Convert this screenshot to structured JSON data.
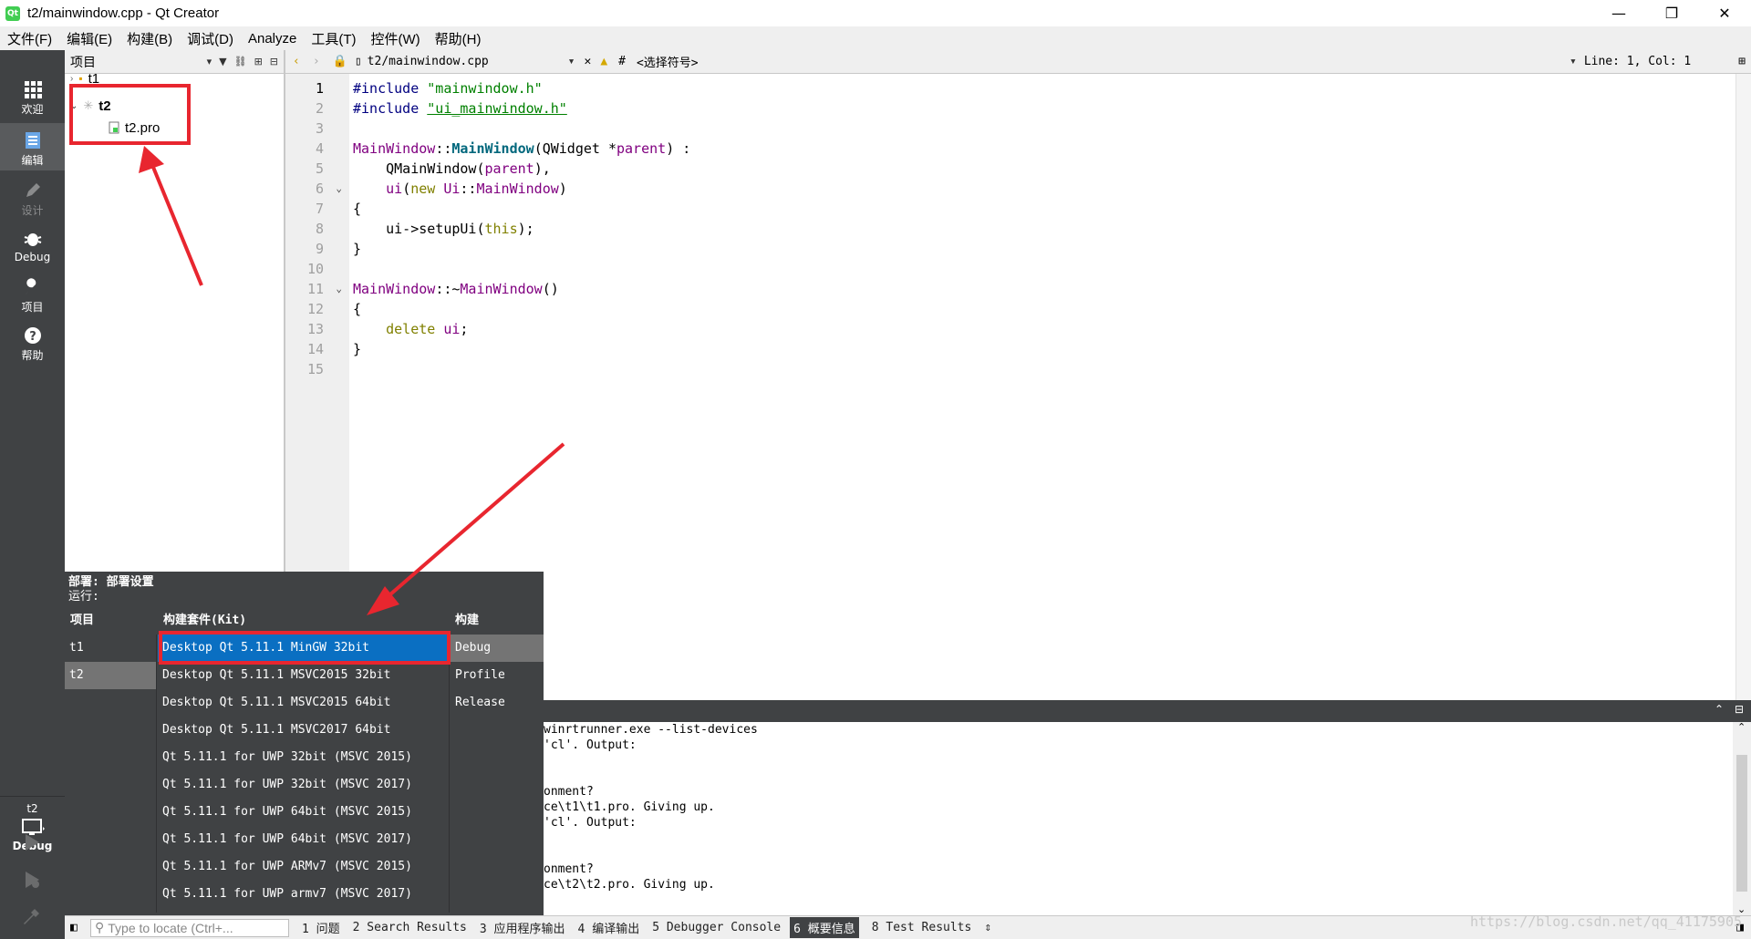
{
  "window": {
    "title": "t2/mainwindow.cpp - Qt Creator",
    "app_icon_text": "Qt",
    "minimize": "—",
    "restore": "❐",
    "close": "✕"
  },
  "menu": [
    "文件(F)",
    "编辑(E)",
    "构建(B)",
    "调试(D)",
    "Analyze",
    "工具(T)",
    "控件(W)",
    "帮助(H)"
  ],
  "modes": [
    {
      "label": "欢迎",
      "icon": "grid-icon"
    },
    {
      "label": "编辑",
      "icon": "document-icon"
    },
    {
      "label": "设计",
      "icon": "pencil-icon"
    },
    {
      "label": "Debug",
      "icon": "bug-icon"
    },
    {
      "label": "项目",
      "icon": "wrench-icon"
    },
    {
      "label": "帮助",
      "icon": "help-icon"
    }
  ],
  "kit_selector": {
    "project": "t2",
    "config": "Debug"
  },
  "project_panel": {
    "title": "项目",
    "tree": [
      {
        "name": "t1",
        "level": 0
      },
      {
        "name": "t2",
        "level": 0
      },
      {
        "name": "t2.pro",
        "level": 1
      }
    ]
  },
  "editor": {
    "file": "t2/mainwindow.cpp",
    "symbol_placeholder": "<选择符号>",
    "hash": "#",
    "position": "Line: 1, Col: 1",
    "line_numbers": [
      "1",
      "2",
      "3",
      "4",
      "5",
      "6",
      "7",
      "8",
      "9",
      "10",
      "11",
      "12",
      "13",
      "14",
      "15"
    ]
  },
  "code": {
    "l1a": "#include ",
    "l1b": "\"mainwindow.h\"",
    "l2a": "#include ",
    "l2b": "\"ui_mainwindow.h\"",
    "l4a": "MainWindow",
    "l4b": "::",
    "l4c": "MainWindow",
    "l4d": "(QWidget *",
    "l4e": "parent",
    "l4f": ") :",
    "l5a": "    ",
    "l5b": "QMainWindow",
    "l5c": "(",
    "l5d": "parent",
    "l5e": "),",
    "l6a": "    ",
    "l6b": "ui",
    "l6c": "(",
    "l6d": "new ",
    "l6e": "Ui",
    "l6f": "::",
    "l6g": "MainWindow",
    "l6h": ")",
    "l7": "{",
    "l8a": "    ui->setupUi(",
    "l8b": "this",
    "l8c": ");",
    "l9": "}",
    "l11a": "MainWindow",
    "l11b": "::~",
    "l11c": "MainWindow",
    "l11d": "()",
    "l12": "{",
    "l13a": "    ",
    "l13b": "delete ",
    "l13c": "ui",
    "l13d": ";",
    "l14": "}"
  },
  "output_lines": [
    "winrtrunner.exe --list-devices",
    "'cl'. Output:",
    "",
    "",
    "onment?",
    "ce\\t1\\t1.pro. Giving up.",
    "'cl'. Output:",
    "",
    "",
    "onment?",
    "ce\\t2\\t2.pro. Giving up."
  ],
  "kit_popup": {
    "deploy": "部署: 部署设置",
    "run": "运行:",
    "col_project": "项目",
    "col_kit": "构建套件(Kit)",
    "col_build": "构建",
    "projects": [
      "t1",
      "t2"
    ],
    "kits": [
      "Desktop Qt 5.11.1 MinGW 32bit",
      "Desktop Qt 5.11.1 MSVC2015 32bit",
      "Desktop Qt 5.11.1 MSVC2015 64bit",
      "Desktop Qt 5.11.1 MSVC2017 64bit",
      "Qt 5.11.1 for UWP 32bit (MSVC 2015)",
      "Qt 5.11.1 for UWP 32bit (MSVC 2017)",
      "Qt 5.11.1 for UWP 64bit (MSVC 2015)",
      "Qt 5.11.1 for UWP 64bit (MSVC 2017)",
      "Qt 5.11.1 for UWP ARMv7 (MSVC 2015)",
      "Qt 5.11.1 for UWP armv7 (MSVC 2017)"
    ],
    "builds": [
      "Debug",
      "Profile",
      "Release"
    ]
  },
  "status": {
    "locate_placeholder": "Type to locate (Ctrl+...",
    "tabs": [
      "1 问题",
      "2 Search Results",
      "3 应用程序输出",
      "4 编译输出",
      "5 Debugger Console",
      "6 概要信息",
      "8 Test Results"
    ],
    "more": "⇕"
  },
  "watermark": "https://blog.csdn.net/qq_41175905",
  "colors": {
    "annotation_red": "#e8262f",
    "selection_blue": "#0a6fc2",
    "sidebar": "#404244"
  }
}
